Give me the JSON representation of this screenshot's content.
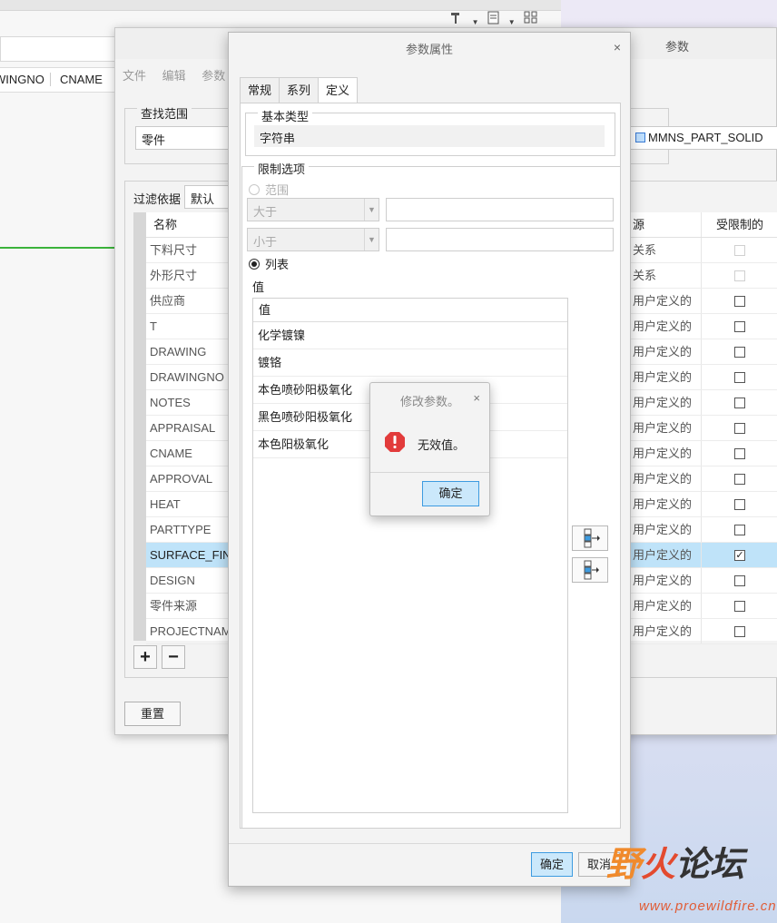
{
  "background": {
    "toolbar_icons": [
      "hammer-icon",
      "document-icon",
      "grid-icon"
    ],
    "columns": [
      "WINGNO",
      "CNAME"
    ]
  },
  "param_dialog": {
    "title": "参数",
    "menu": [
      "文件",
      "编辑",
      "参数"
    ],
    "lookup": {
      "legend": "查找范围",
      "value": "零件",
      "part": "MMNS_PART_SOLID"
    },
    "filter": {
      "label": "过滤依据",
      "value": "默认"
    },
    "table": {
      "headers": {
        "name": "名称",
        "source": "源",
        "restricted": "受限制的"
      },
      "rows": [
        {
          "name": "下料尺寸",
          "source": "关系",
          "checked": false,
          "disabled": true
        },
        {
          "name": "外形尺寸",
          "source": "关系",
          "checked": false,
          "disabled": true
        },
        {
          "name": "供应商",
          "source": "用户定义的",
          "checked": false,
          "disabled": false
        },
        {
          "name": "T",
          "source": "用户定义的",
          "checked": false,
          "disabled": false
        },
        {
          "name": "DRAWING",
          "source": "用户定义的",
          "checked": false,
          "disabled": false
        },
        {
          "name": "DRAWINGNO",
          "source": "用户定义的",
          "checked": false,
          "disabled": false
        },
        {
          "name": "NOTES",
          "source": "用户定义的",
          "checked": false,
          "disabled": false
        },
        {
          "name": "APPRAISAL",
          "source": "用户定义的",
          "checked": false,
          "disabled": false
        },
        {
          "name": "CNAME",
          "source": "用户定义的",
          "checked": false,
          "disabled": false
        },
        {
          "name": "APPROVAL",
          "source": "用户定义的",
          "checked": false,
          "disabled": false
        },
        {
          "name": "HEAT",
          "source": "用户定义的",
          "checked": false,
          "disabled": false
        },
        {
          "name": "PARTTYPE",
          "source": "用户定义的",
          "checked": false,
          "disabled": false
        },
        {
          "name": "SURFACE_FINISH",
          "source": "用户定义的",
          "checked": true,
          "disabled": false,
          "selected": true
        },
        {
          "name": "DESIGN",
          "source": "用户定义的",
          "checked": false,
          "disabled": false
        },
        {
          "name": "零件来源",
          "source": "用户定义的",
          "checked": false,
          "disabled": false
        },
        {
          "name": "PROJECTNAME",
          "source": "用户定义的",
          "checked": false,
          "disabled": false
        }
      ]
    },
    "add_label": "+",
    "remove_label": "−",
    "reset_label": "重置"
  },
  "prop_dialog": {
    "title": "参数属性",
    "close": "×",
    "tabs": [
      "常规",
      "系列",
      "定义"
    ],
    "active_tab": 2,
    "basic_type": {
      "legend": "基本类型",
      "value": "字符串"
    },
    "limit": {
      "legend": "限制选项",
      "range_label": "范围",
      "greater": "大于",
      "less": "小于",
      "list_label": "列表",
      "value_label": "值",
      "list_header": "值",
      "values": [
        "化学镀镍",
        "镀铬",
        "本色喷砂阳极氧化",
        "黑色喷砂阳极氧化",
        "本色阳极氧化"
      ]
    },
    "ok_label": "确定",
    "cancel_label": "取消"
  },
  "message_box": {
    "title": "修改参数。",
    "close": "×",
    "text": "无效值。",
    "ok_label": "确定",
    "icon": "error-icon",
    "icon_color": "#e23b3b"
  },
  "watermark": {
    "logo_text": "野火论坛",
    "url": "www.proewildfire.cn",
    "colors": {
      "orange": "#f08a2c",
      "red": "#e34a2f",
      "dark": "#333333"
    }
  }
}
